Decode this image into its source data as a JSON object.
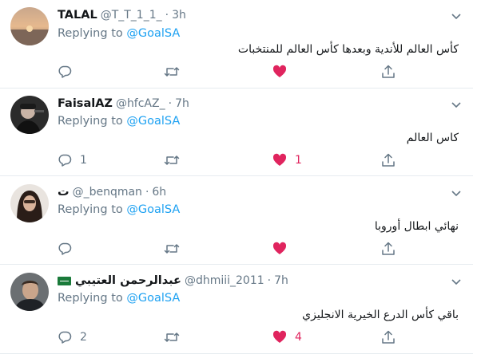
{
  "tweets": [
    {
      "name": "TALAL",
      "handle": "@T_T_1_1_",
      "time": "3h",
      "reply_prefix": "Replying to",
      "reply_mention": "@GoalSA",
      "text": "كأس العالم للأندية وبعدها كأس العالم للمنتخبات",
      "reply_count": "",
      "like_count": ""
    },
    {
      "name": "FaisalAZ",
      "handle": "@hfcAZ_",
      "time": "7h",
      "reply_prefix": "Replying to",
      "reply_mention": "@GoalSA",
      "text": "كاس العالم",
      "reply_count": "1",
      "like_count": "1"
    },
    {
      "name": "ت",
      "handle": "@_benqman",
      "time": "6h",
      "reply_prefix": "Replying to",
      "reply_mention": "@GoalSA",
      "text": "نهائي ابطال أوروبا",
      "reply_count": "",
      "like_count": ""
    },
    {
      "name": "عبدالرحمن العتيبي",
      "handle": "@dhmiii_2011",
      "time": "7h",
      "reply_prefix": "Replying to",
      "reply_mention": "@GoalSA",
      "text": "باقي كأس الدرع الخيرية الانجليزي",
      "reply_count": "2",
      "like_count": "4"
    }
  ],
  "colors": {
    "like_active": "#e0245e",
    "mention": "#1da1f2",
    "secondary_text": "#657786",
    "divider": "#e6ecf0"
  },
  "icons": [
    "reply-icon",
    "retweet-icon",
    "like-icon",
    "share-icon",
    "caret-down-icon",
    "saudi-flag-icon"
  ]
}
